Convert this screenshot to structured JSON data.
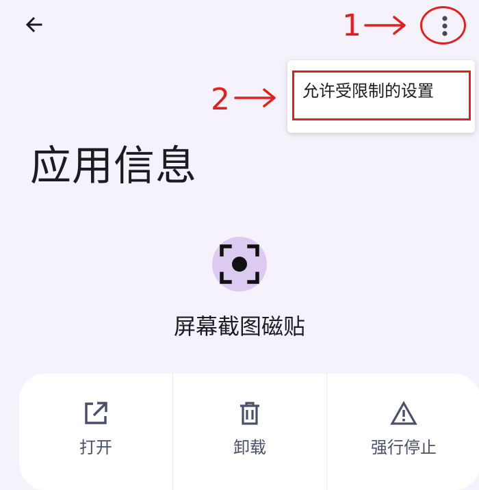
{
  "header": {
    "back_icon": "arrow-left-icon",
    "more_icon": "more-vert-icon"
  },
  "overflow_menu": {
    "items": [
      {
        "label": "允许受限制的设置"
      }
    ]
  },
  "annotations": {
    "step1": "1",
    "step2": "2",
    "color": "#e0201c"
  },
  "page": {
    "title": "应用信息"
  },
  "app": {
    "name": "屏幕截图磁贴",
    "icon": "screenshot-icon",
    "icon_bg": "#dccaf0"
  },
  "actions": [
    {
      "label": "打开",
      "icon": "open-external-icon"
    },
    {
      "label": "卸载",
      "icon": "trash-icon"
    },
    {
      "label": "强行停止",
      "icon": "warning-icon"
    }
  ],
  "colors": {
    "background": "#f6f2fb",
    "action_icon": "#4a4f6b"
  }
}
